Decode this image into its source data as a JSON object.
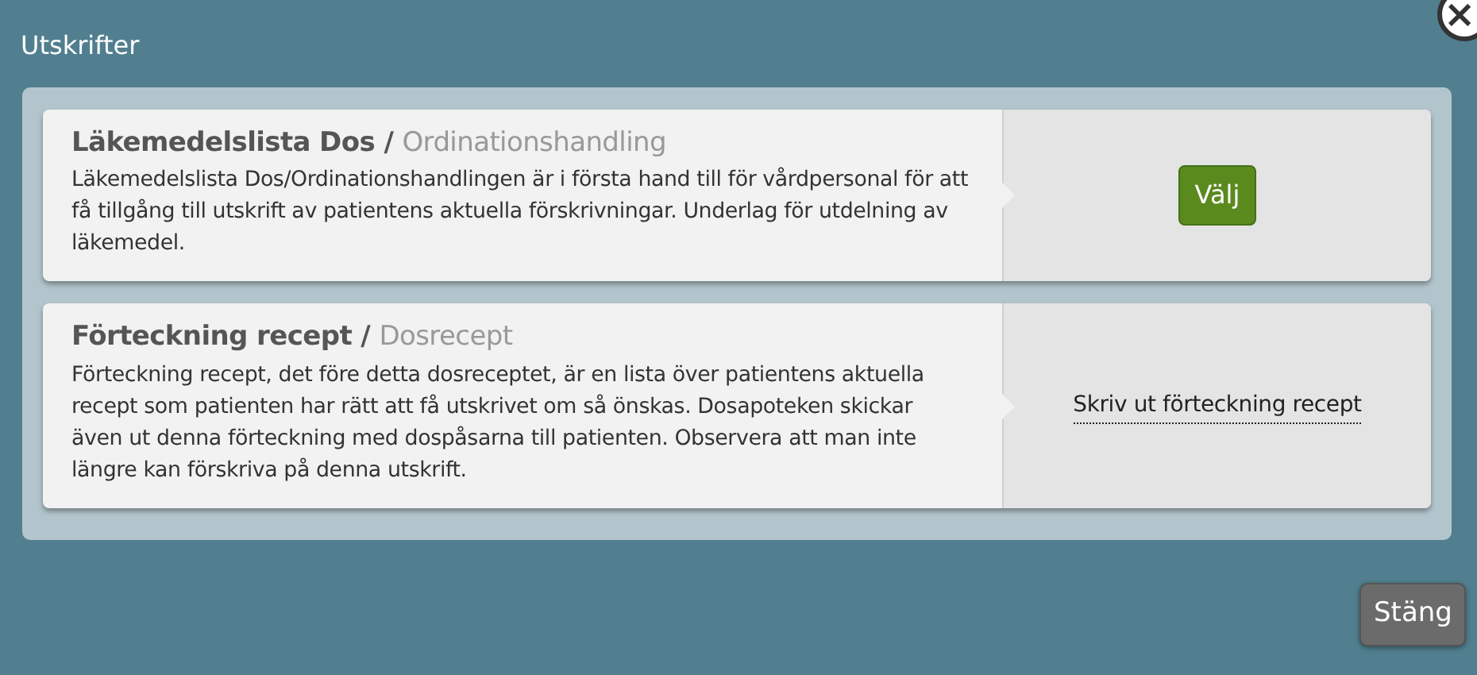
{
  "dialog": {
    "title": "Utskrifter",
    "close_icon": "×"
  },
  "options": [
    {
      "title": "Läkemedelslista Dos /",
      "subtitle": "Ordinationshandling",
      "description": "Läkemedelslista Dos/Ordinationshandlingen är i första hand till för vårdpersonal för att få tillgång till utskrift av patientens aktuella förskrivningar. Underlag för utdelning av läkemedel.",
      "action": {
        "kind": "button",
        "label": "Välj"
      }
    },
    {
      "title": "Förteckning recept /",
      "subtitle": "Dosrecept",
      "description": "Förteckning recept, det före detta dosreceptet, är en lista över patientens aktuella recept som patienten har rätt att få utskrivet om så önskas. Dosapoteken skickar även ut denna förteckning med dospåsarna till patienten. Observera att man inte längre kan förskriva på denna utskrift.",
      "action": {
        "kind": "link",
        "label": "Skriv ut förteckning recept"
      }
    }
  ],
  "footer": {
    "close_button": "Stäng"
  }
}
